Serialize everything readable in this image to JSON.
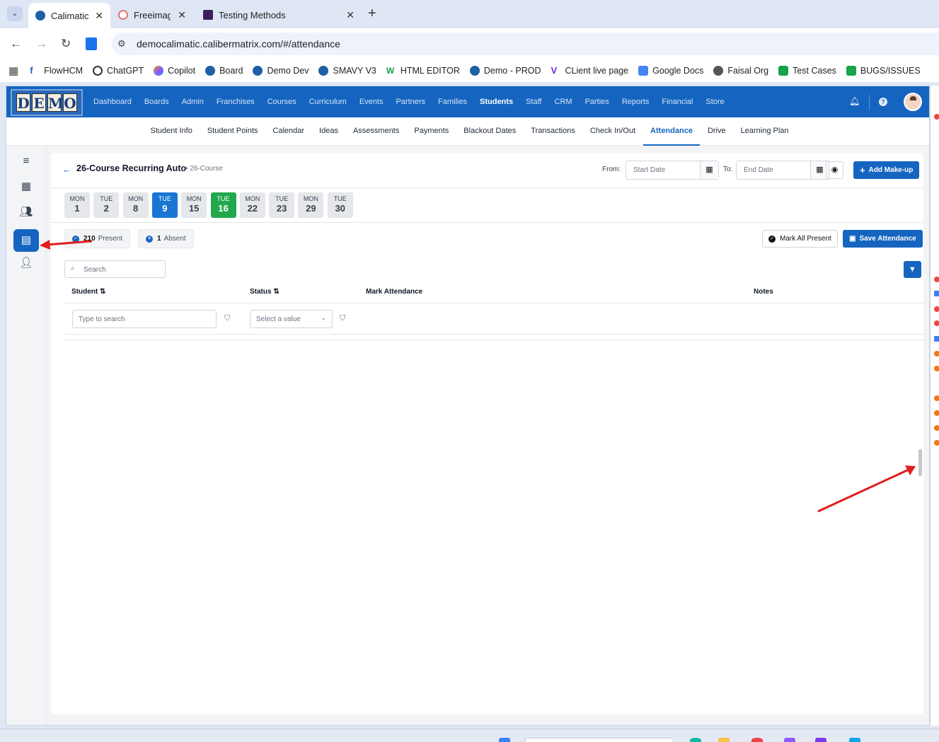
{
  "browser": {
    "tabs": [
      {
        "title": "Calimatic",
        "active": true
      },
      {
        "title": "Freeimag",
        "active": false
      },
      {
        "title": "Testing Methods",
        "active": false
      }
    ],
    "url": "democalimatic.calibermatrix.com/#/attendance",
    "bookmarks": [
      "FlowHCM",
      "ChatGPT",
      "Copilot",
      "Board",
      "Demo Dev",
      "SMAVY V3",
      "HTML EDITOR",
      "Demo - PROD",
      "CLient live page",
      "Google Docs",
      "Faisal Org",
      "Test Cases",
      "BUGS/ISSUES"
    ]
  },
  "app": {
    "logo_letters": [
      "D",
      "E",
      "M",
      "O"
    ],
    "menu": [
      "Dashboard",
      "Boards",
      "Admin",
      "Franchises",
      "Courses",
      "Curriculum",
      "Events",
      "Partners",
      "Families",
      "Students",
      "Staff",
      "CRM",
      "Parties",
      "Reports",
      "Financial",
      "Store"
    ],
    "active_menu": "Students",
    "subnav": [
      "Student Info",
      "Student Points",
      "Calendar",
      "Ideas",
      "Assessments",
      "Payments",
      "Blackout Dates",
      "Transactions",
      "Check In/Out",
      "Attendance",
      "Drive",
      "Learning Plan"
    ],
    "active_subnav": "Attendance"
  },
  "attendance": {
    "course_title": "26-Course Recurring Auto",
    "course_sub": "• 26-Course",
    "from_label": "From:",
    "to_label": "To:",
    "start_placeholder": "Start Date",
    "end_placeholder": "End Date",
    "add_makeup": "Add Make-up",
    "days": [
      {
        "dow": "MON",
        "num": "1",
        "state": "normal"
      },
      {
        "dow": "TUE",
        "num": "2",
        "state": "normal"
      },
      {
        "dow": "MON",
        "num": "8",
        "state": "normal"
      },
      {
        "dow": "TUE",
        "num": "9",
        "state": "selected"
      },
      {
        "dow": "MON",
        "num": "15",
        "state": "normal"
      },
      {
        "dow": "TUE",
        "num": "16",
        "state": "today"
      },
      {
        "dow": "MON",
        "num": "22",
        "state": "normal"
      },
      {
        "dow": "TUE",
        "num": "23",
        "state": "normal"
      },
      {
        "dow": "MON",
        "num": "29",
        "state": "normal"
      },
      {
        "dow": "TUE",
        "num": "30",
        "state": "normal"
      }
    ],
    "present_count": "210",
    "present_label": "Present",
    "absent_count": "1",
    "absent_label": "Absent",
    "mark_all_present": "Mark All Present",
    "save_attendance": "Save Attendance",
    "search_placeholder": "Search",
    "columns": [
      "Student",
      "Status",
      "Mark Attendance",
      "Notes"
    ],
    "student_filter_placeholder": "Type to search",
    "status_filter_placeholder": "Select a value"
  },
  "colors": {
    "brand": "#1565c0",
    "selected_day": "#1976d2",
    "today_day": "#21a84d",
    "annotation_arrow": "#e11d1d"
  }
}
